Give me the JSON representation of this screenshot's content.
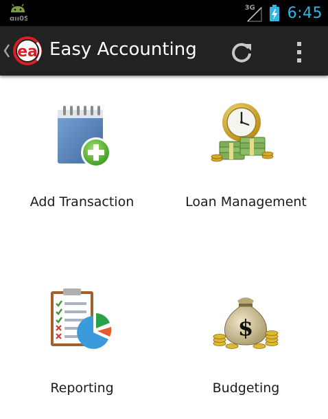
{
  "status_bar": {
    "network_type": "3G",
    "time": "6:45"
  },
  "action_bar": {
    "title": "Easy Accounting",
    "logo_text": "ea"
  },
  "menu": [
    {
      "label": "Add Transaction",
      "icon": "add-transaction-icon"
    },
    {
      "label": "Loan Management",
      "icon": "loan-management-icon"
    },
    {
      "label": "Reporting",
      "icon": "reporting-icon"
    },
    {
      "label": "Budgeting",
      "icon": "budgeting-icon"
    }
  ],
  "colors": {
    "accent_clock": "#33b5e5",
    "action_bar_bg": "#222222",
    "logo_red": "#d61f26"
  }
}
